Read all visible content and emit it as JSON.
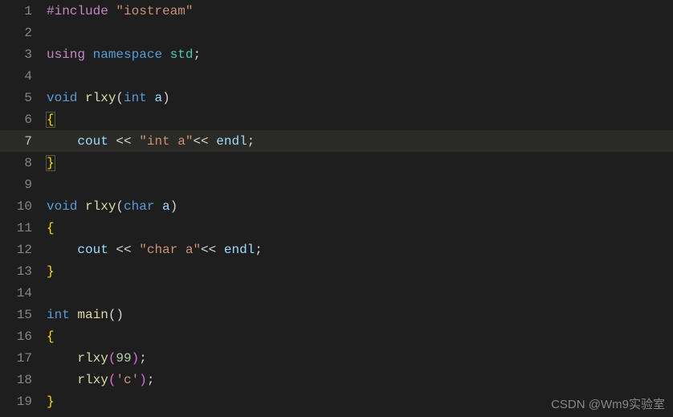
{
  "editor": {
    "current_line": 7,
    "lines": [
      {
        "n": 1,
        "tokens": [
          [
            "pp",
            "#include"
          ],
          [
            "",
            ""
          ],
          [
            "punct",
            " "
          ],
          [
            "str",
            "\"iostream\""
          ]
        ]
      },
      {
        "n": 2,
        "tokens": []
      },
      {
        "n": 3,
        "tokens": [
          [
            "pp",
            "using"
          ],
          [
            "punct",
            " "
          ],
          [
            "kw",
            "namespace"
          ],
          [
            "punct",
            " "
          ],
          [
            "ns",
            "std"
          ],
          [
            "punct",
            ";"
          ]
        ]
      },
      {
        "n": 4,
        "tokens": []
      },
      {
        "n": 5,
        "tokens": [
          [
            "kw",
            "void"
          ],
          [
            "punct",
            " "
          ],
          [
            "fn",
            "rlxy"
          ],
          [
            "punct",
            "("
          ],
          [
            "kw",
            "int"
          ],
          [
            "punct",
            " "
          ],
          [
            "ident",
            "a"
          ],
          [
            "punct",
            ")"
          ]
        ]
      },
      {
        "n": 6,
        "tokens": [
          [
            "bracey brace-hl",
            "{"
          ]
        ]
      },
      {
        "n": 7,
        "tokens": [
          [
            "punct",
            "    "
          ],
          [
            "ident",
            "cout"
          ],
          [
            "punct",
            " "
          ],
          [
            "punct",
            "<<"
          ],
          [
            "punct",
            " "
          ],
          [
            "str",
            "\"int a\""
          ],
          [
            "punct",
            "<<"
          ],
          [
            "punct",
            " "
          ],
          [
            "ident",
            "endl"
          ],
          [
            "punct",
            ";"
          ]
        ]
      },
      {
        "n": 8,
        "tokens": [
          [
            "bracey brace-hl",
            "}"
          ]
        ]
      },
      {
        "n": 9,
        "tokens": []
      },
      {
        "n": 10,
        "tokens": [
          [
            "kw",
            "void"
          ],
          [
            "punct",
            " "
          ],
          [
            "fn",
            "rlxy"
          ],
          [
            "punct",
            "("
          ],
          [
            "kw",
            "char"
          ],
          [
            "punct",
            " "
          ],
          [
            "ident",
            "a"
          ],
          [
            "punct",
            ")"
          ]
        ]
      },
      {
        "n": 11,
        "tokens": [
          [
            "bracey",
            "{"
          ]
        ]
      },
      {
        "n": 12,
        "tokens": [
          [
            "punct",
            "    "
          ],
          [
            "ident",
            "cout"
          ],
          [
            "punct",
            " "
          ],
          [
            "punct",
            "<<"
          ],
          [
            "punct",
            " "
          ],
          [
            "str",
            "\"char a\""
          ],
          [
            "punct",
            "<<"
          ],
          [
            "punct",
            " "
          ],
          [
            "ident",
            "endl"
          ],
          [
            "punct",
            ";"
          ]
        ]
      },
      {
        "n": 13,
        "tokens": [
          [
            "bracey",
            "}"
          ]
        ]
      },
      {
        "n": 14,
        "tokens": []
      },
      {
        "n": 15,
        "tokens": [
          [
            "kw",
            "int"
          ],
          [
            "punct",
            " "
          ],
          [
            "fn",
            "main"
          ],
          [
            "punct",
            "()"
          ]
        ]
      },
      {
        "n": 16,
        "tokens": [
          [
            "bracey",
            "{"
          ]
        ]
      },
      {
        "n": 17,
        "tokens": [
          [
            "punct",
            "    "
          ],
          [
            "fn",
            "rlxy"
          ],
          [
            "bracep",
            "("
          ],
          [
            "num",
            "99"
          ],
          [
            "bracep",
            ")"
          ],
          [
            "punct",
            ";"
          ]
        ]
      },
      {
        "n": 18,
        "tokens": [
          [
            "punct",
            "    "
          ],
          [
            "fn",
            "rlxy"
          ],
          [
            "bracep",
            "("
          ],
          [
            "str",
            "'c'"
          ],
          [
            "bracep",
            ")"
          ],
          [
            "punct",
            ";"
          ]
        ]
      },
      {
        "n": 19,
        "tokens": [
          [
            "bracey",
            "}"
          ]
        ]
      }
    ]
  },
  "watermark": "CSDN @Wm9实验室"
}
